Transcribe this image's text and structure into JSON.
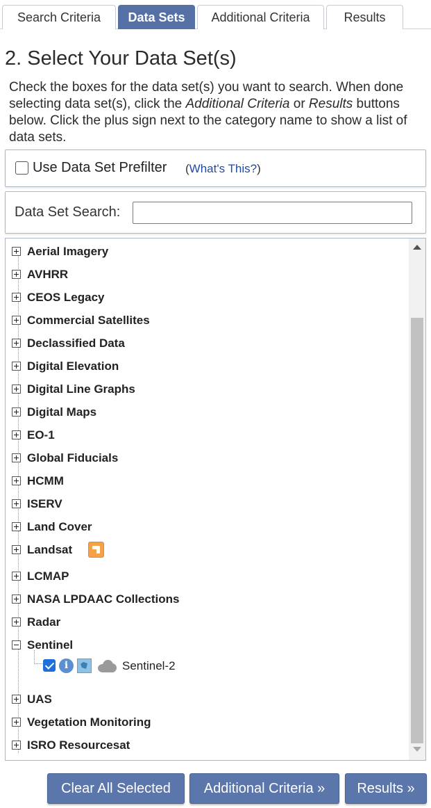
{
  "tabs": [
    {
      "label": "Search Criteria"
    },
    {
      "label": "Data Sets"
    },
    {
      "label": "Additional Criteria"
    },
    {
      "label": "Results"
    }
  ],
  "active_tab": "Data Sets",
  "heading": "2. Select Your Data Set(s)",
  "instructions": {
    "part1": "Check the boxes for the data set(s) you want to search. When done selecting data set(s), click the ",
    "em1": "Additional Criteria",
    "part2": " or ",
    "em2": "Results",
    "part3": " buttons below. Click the plus sign next to the category name to show a list of data sets."
  },
  "prefilter": {
    "label": "Use Data Set Prefilter",
    "help_open": "(",
    "help_link": "What's This?",
    "help_close": ")",
    "checked": false
  },
  "search": {
    "label": "Data Set Search:",
    "value": "",
    "placeholder": ""
  },
  "categories": [
    {
      "label": "Aerial Imagery",
      "expanded": false
    },
    {
      "label": "AVHRR",
      "expanded": false
    },
    {
      "label": "CEOS Legacy",
      "expanded": false
    },
    {
      "label": "Commercial Satellites",
      "expanded": false
    },
    {
      "label": "Declassified Data",
      "expanded": false
    },
    {
      "label": "Digital Elevation",
      "expanded": false
    },
    {
      "label": "Digital Line Graphs",
      "expanded": false
    },
    {
      "label": "Digital Maps",
      "expanded": false
    },
    {
      "label": "EO-1",
      "expanded": false
    },
    {
      "label": "Global Fiducials",
      "expanded": false
    },
    {
      "label": "HCMM",
      "expanded": false
    },
    {
      "label": "ISERV",
      "expanded": false
    },
    {
      "label": "Land Cover",
      "expanded": false
    },
    {
      "label": "Landsat",
      "expanded": false,
      "icon": "rss-icon"
    },
    {
      "label": "LCMAP",
      "expanded": false
    },
    {
      "label": "NASA LPDAAC Collections",
      "expanded": false
    },
    {
      "label": "Radar",
      "expanded": false
    },
    {
      "label": "Sentinel",
      "expanded": true
    },
    {
      "label": "UAS",
      "expanded": false
    },
    {
      "label": "Vegetation Monitoring",
      "expanded": false
    },
    {
      "label": "ISRO Resourcesat",
      "expanded": false
    }
  ],
  "sentinel_child": {
    "label": "Sentinel-2",
    "checked": true,
    "icons": [
      "info-icon",
      "map-footprint-icon",
      "cloud-icon"
    ]
  },
  "buttons": {
    "clear": "Clear All Selected",
    "additional": "Additional Criteria »",
    "results": "Results »"
  },
  "colors": {
    "accent": "#5470a5",
    "button": "#5a76aa",
    "link": "#1f4aa8"
  }
}
